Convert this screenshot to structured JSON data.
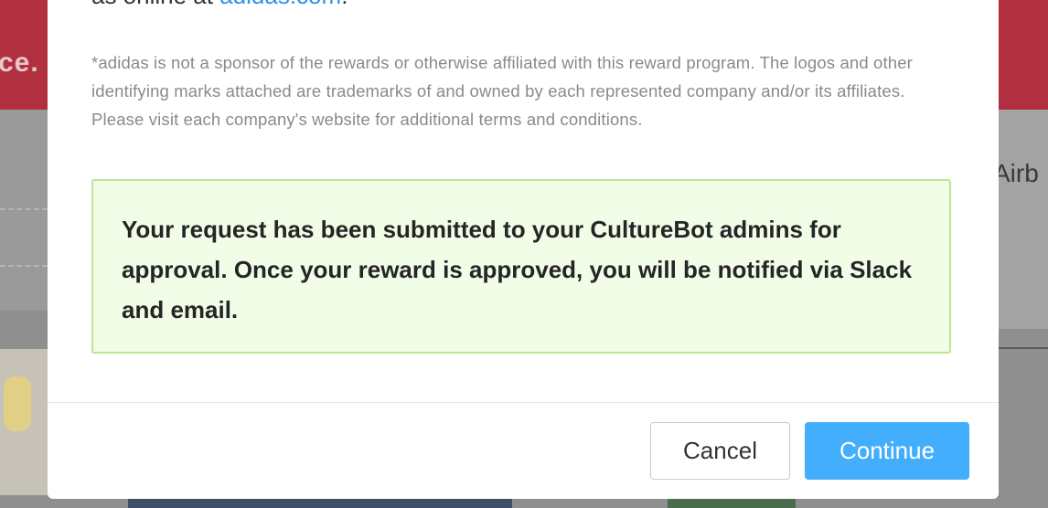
{
  "background": {
    "left_card_text": "ce.",
    "right_label": "Airb"
  },
  "modal": {
    "intro_prefix": "as online at",
    "intro_link": "adidas.com",
    "intro_suffix": ".",
    "disclaimer": "*adidas is not a sponsor of the rewards or otherwise affiliated with this reward program. The logos and other identifying marks attached are trademarks of and owned by each represented company and/or its affiliates. Please visit each company's website for additional terms and conditions.",
    "alert_message": "Your request has been submitted to your CultureBot admins for approval. Once your reward is approved, you will be notified via Slack and email.",
    "cancel_label": "Cancel",
    "continue_label": "Continue"
  },
  "colors": {
    "link": "#2f8fea",
    "alert_bg": "#f2fde8",
    "alert_border": "#b7e795",
    "primary_button": "#43aefc"
  }
}
